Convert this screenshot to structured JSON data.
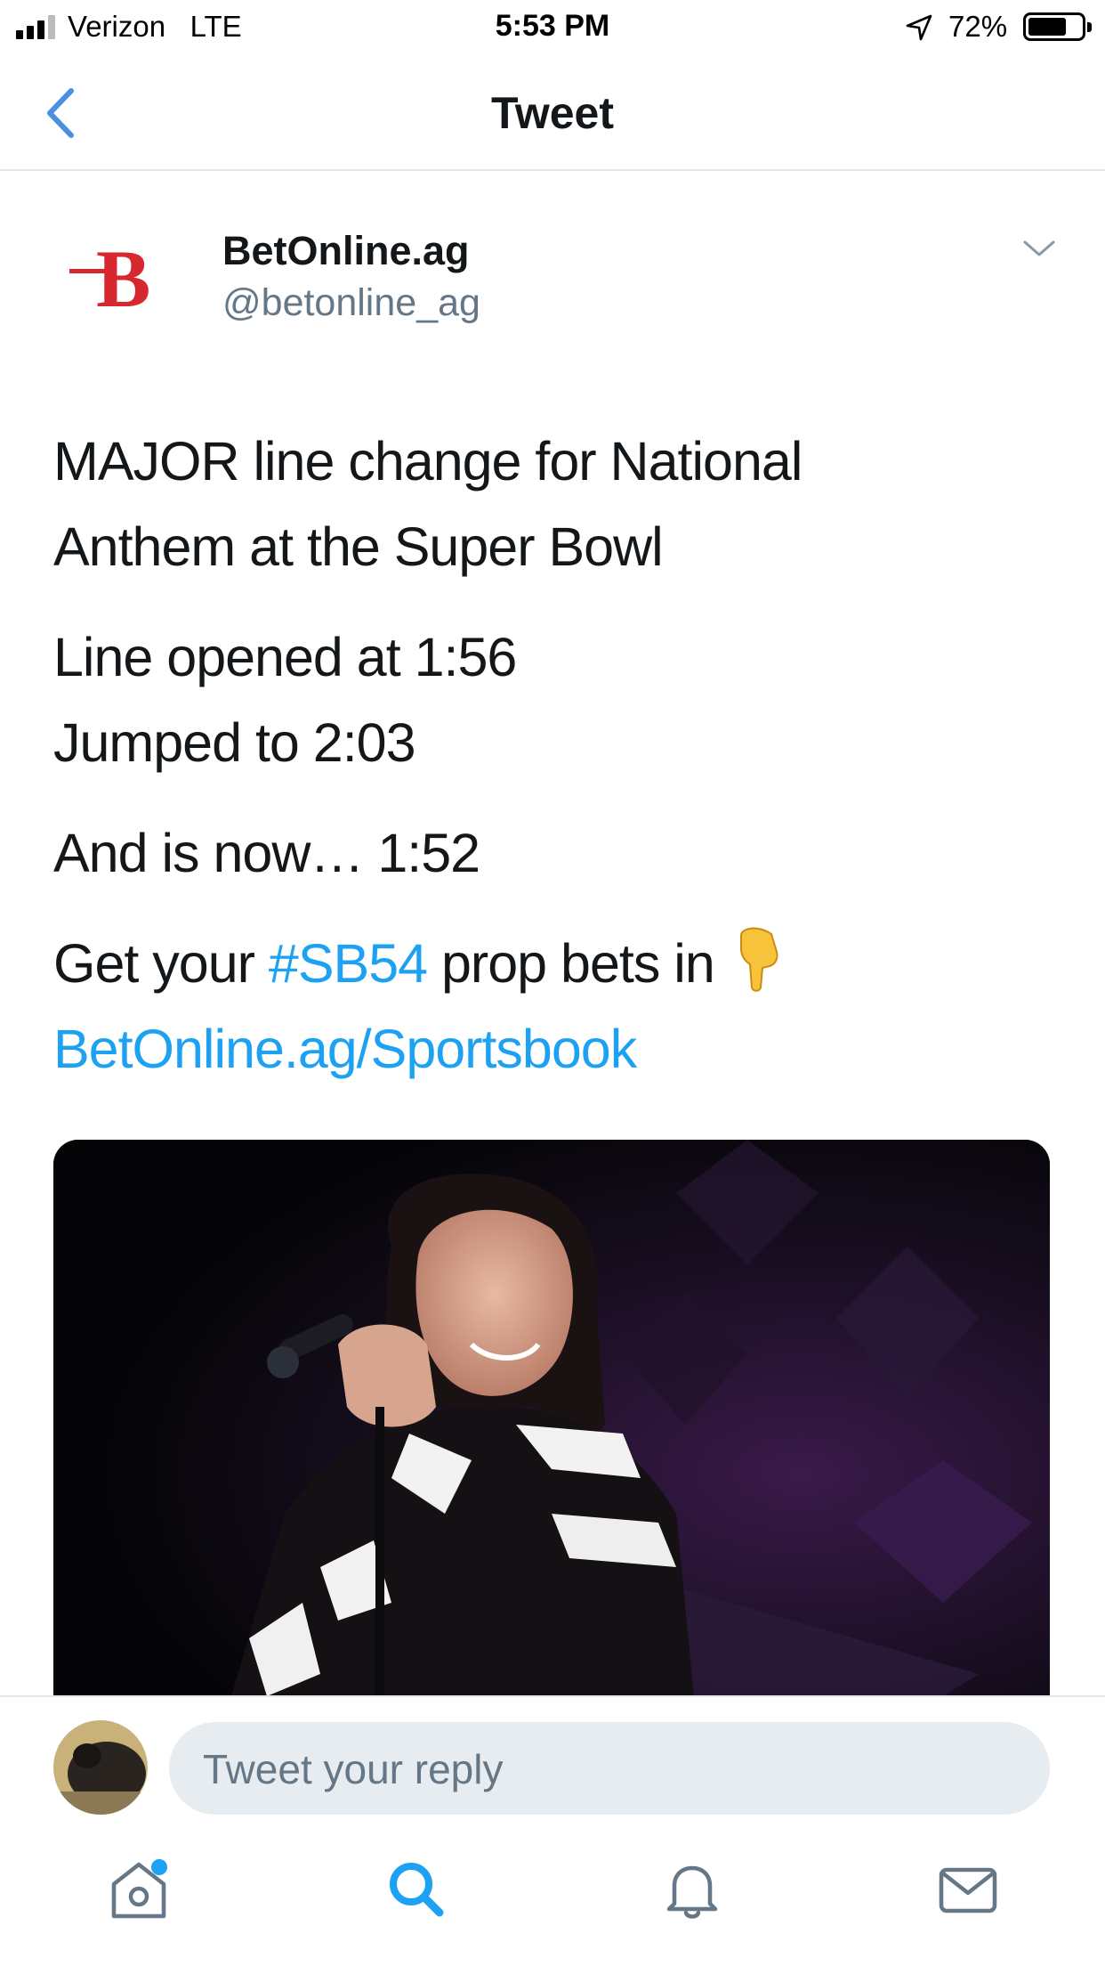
{
  "status_bar": {
    "carrier": "Verizon",
    "network": "LTE",
    "time": "5:53 PM",
    "battery_percent": "72%",
    "battery_level": 0.72,
    "signal_bars_filled": 3,
    "signal_bars_total": 4
  },
  "nav": {
    "title": "Tweet",
    "back_icon": "chevron-left-icon"
  },
  "tweet": {
    "author_name": "BetOnline.ag",
    "author_handle": "@betonline_ag",
    "logo_letter": "B",
    "line1": "MAJOR line change for National",
    "line2": "Anthem at the Super Bowl",
    "line3": "Line opened at 1:56",
    "line4": "Jumped to 2:03",
    "line5": "And is now… 1:52",
    "line6_prefix": "Get your ",
    "hashtag": "#SB54",
    "line6_suffix": " prop bets in",
    "url": "BetOnline.ag/Sportsbook"
  },
  "reply": {
    "placeholder": "Tweet your reply"
  },
  "tabs": [
    {
      "name": "home",
      "icon": "home-icon",
      "has_badge": true
    },
    {
      "name": "search",
      "icon": "search-icon",
      "active": true
    },
    {
      "name": "notifications",
      "icon": "bell-icon"
    },
    {
      "name": "messages",
      "icon": "mail-icon"
    }
  ],
  "colors": {
    "accent": "#1da1f2",
    "back_chevron": "#4a90e2",
    "logo_red": "#d7282f",
    "secondary_text": "#657786",
    "reply_field_bg": "#e6ecf0"
  }
}
